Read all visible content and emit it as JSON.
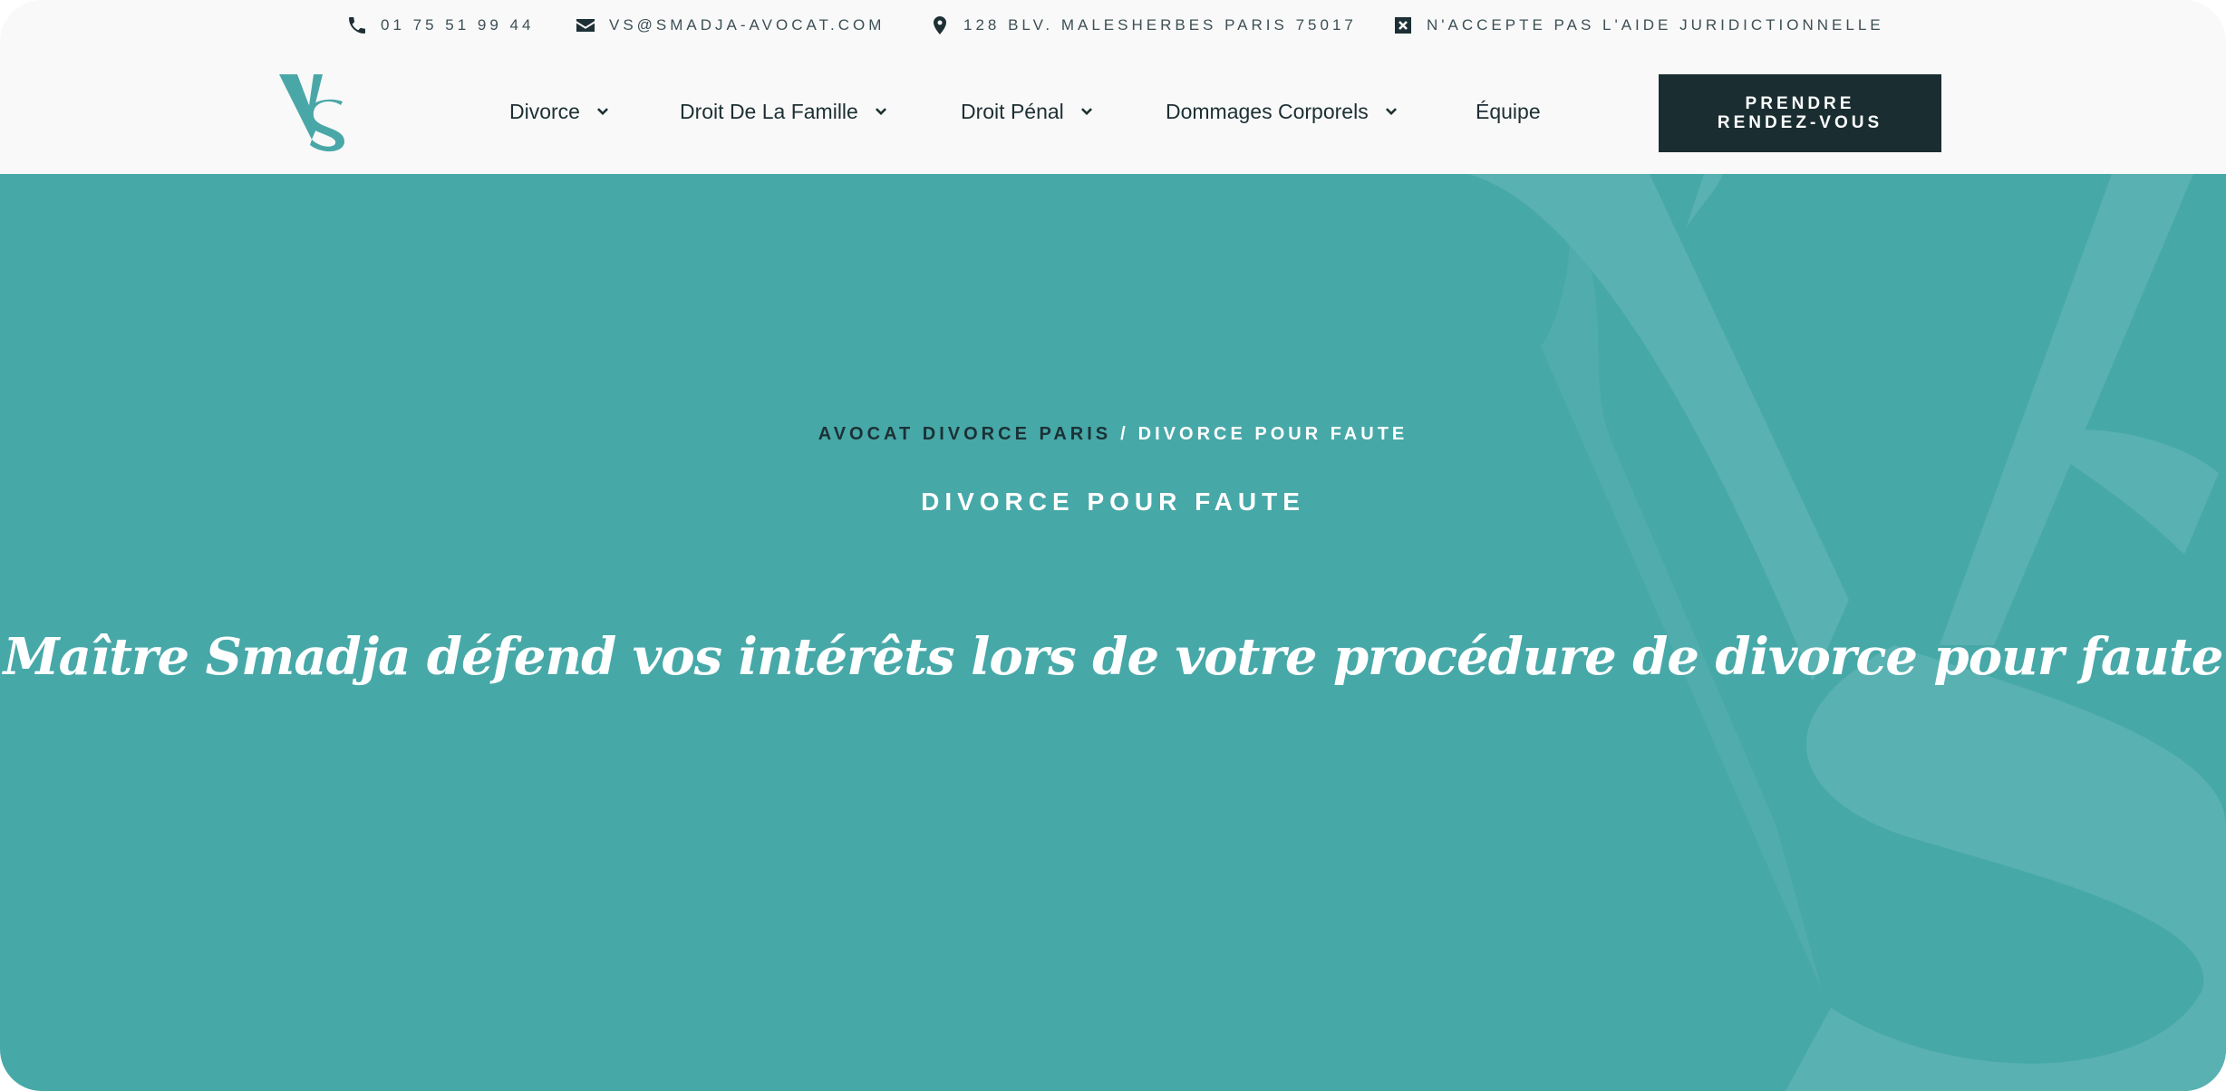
{
  "topbar": {
    "phone": "01 75 51 99 44",
    "email": "VS@SMADJA-AVOCAT.COM",
    "address": "128 BLV. MALESHERBES PARIS 75017",
    "legal_aid": "N'ACCEPTE PAS L'AIDE JURIDICTIONNELLE",
    "icons": [
      "phone-icon",
      "envelope-icon",
      "map-pin-icon",
      "close-square-icon"
    ]
  },
  "header": {
    "logo_text": "VS",
    "nav": [
      {
        "label": "Divorce",
        "has_dropdown": true
      },
      {
        "label": "Droit De La Famille",
        "has_dropdown": true
      },
      {
        "label": "Droit Pénal",
        "has_dropdown": true
      },
      {
        "label": "Dommages Corporels",
        "has_dropdown": true
      },
      {
        "label": "Équipe",
        "has_dropdown": false
      }
    ],
    "cta": {
      "line1": "PRENDRE",
      "line2": "RENDEZ-VOUS"
    }
  },
  "hero": {
    "breadcrumb": {
      "home": "AVOCAT DIVORCE PARIS",
      "separator": "/",
      "current": "DIVORCE POUR FAUTE"
    },
    "subtitle": "DIVORCE POUR FAUTE",
    "headline": "Maître Smadja défend vos intérêts lors de votre procédure de divorce pour faute"
  },
  "colors": {
    "accent": "#47a8a8",
    "dark": "#1a2e31",
    "logo": "#4aa7a8",
    "topbar_bg": "#f9f9f9"
  }
}
